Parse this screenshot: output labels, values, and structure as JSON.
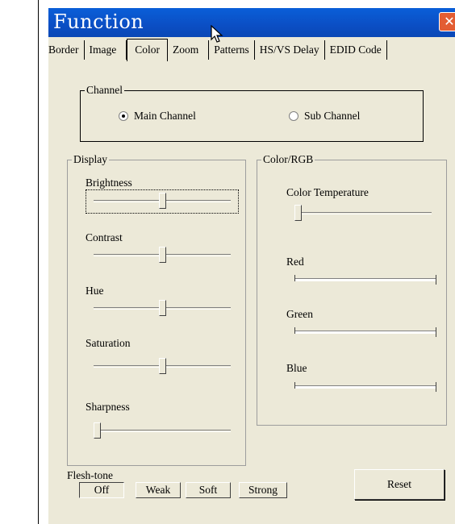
{
  "window": {
    "title": "Function",
    "close_label": "✕"
  },
  "tabs": [
    {
      "label": "Border",
      "active": false
    },
    {
      "label": "Image",
      "active": false
    },
    {
      "label": "Color",
      "active": true
    },
    {
      "label": "Zoom",
      "active": false
    },
    {
      "label": "Patterns",
      "active": false
    },
    {
      "label": "HS/VS Delay",
      "active": false
    },
    {
      "label": "EDID Code",
      "active": false
    }
  ],
  "channel": {
    "title": "Channel",
    "main_label": "Main Channel",
    "sub_label": "Sub Channel",
    "selected": "Main Channel"
  },
  "display": {
    "title": "Display",
    "brightness": {
      "label": "Brightness",
      "level": 0.5
    },
    "contrast": {
      "label": "Contrast",
      "level": 0.5
    },
    "hue": {
      "label": "Hue",
      "level": 0.5
    },
    "saturation": {
      "label": "Saturation",
      "level": 0.5
    },
    "sharpness": {
      "label": "Sharpness",
      "level": 0.0
    }
  },
  "color_rgb": {
    "title": "Color/RGB",
    "color_temperature": {
      "label": "Color Temperature",
      "level": 0.0
    },
    "red": {
      "label": "Red",
      "level": 1.0
    },
    "green": {
      "label": "Green",
      "level": 1.0
    },
    "blue": {
      "label": "Blue",
      "level": 1.0
    }
  },
  "flesh_tone": {
    "label": "Flesh-tone",
    "options": [
      "Off",
      "Weak",
      "Soft",
      "Strong"
    ],
    "selected": "Off"
  },
  "reset_label": "Reset",
  "icons": {
    "close": "close-icon",
    "cursor": "mouse-pointer-icon"
  },
  "colors": {
    "titlebar": "#0b4ec4",
    "close": "#e35d33",
    "window_bg": "#ece9d8"
  }
}
